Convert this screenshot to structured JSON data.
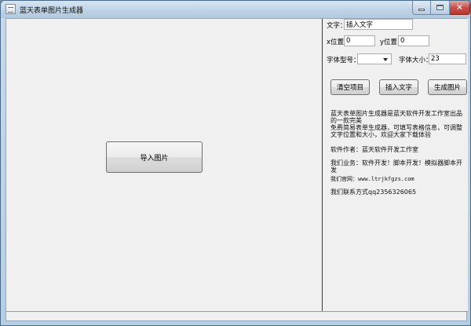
{
  "window": {
    "title": "蓝天表单图片生成器",
    "close_glyph": "✕"
  },
  "left": {
    "import_button": "导入图片"
  },
  "form": {
    "text_label": "文字：",
    "text_value": "插入文字",
    "x_label": "x位置",
    "x_value": "0",
    "y_label": "y位置:",
    "y_value": "0",
    "font_type_label": "字体型号：",
    "font_type_value": "",
    "font_size_label": "字体大小：",
    "font_size_value": "23"
  },
  "actions": {
    "clear": "清空项目",
    "insert_text": "插入文字",
    "generate": "生成图片"
  },
  "info": {
    "line1": "蓝天表单图片生成器是蓝天软件开发工作室出品的一款完美",
    "line2": "免费简易表单生成器，可填写表格信息，可调整文字位置和大小，欢迎大家下载体验",
    "author": "软件作者：蓝天软件开发工作室",
    "business": "我们业务：软件开发！脚本开发！模拟器脚本开发",
    "website": "我们官网：www.ltrjkfgzs.com",
    "contact": "我们联系方式qq2356326065"
  }
}
